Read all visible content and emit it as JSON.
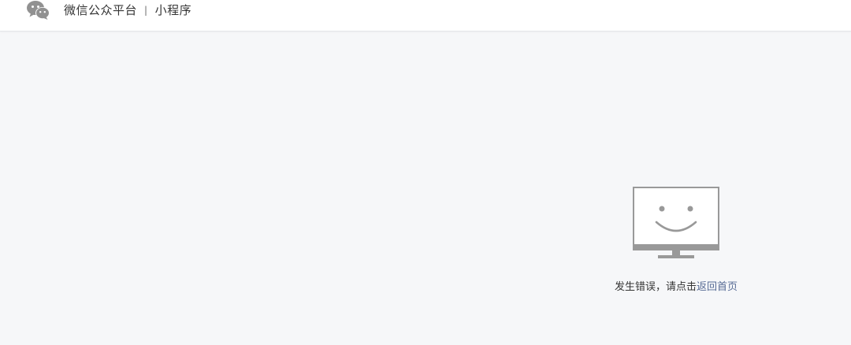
{
  "header": {
    "logo_icon": "wechat-logo-icon",
    "brand_name": "微信公众平台",
    "separator": "|",
    "product": "小程序"
  },
  "error": {
    "icon": "smiley-monitor-icon",
    "message": "发生错误，请点击",
    "link_label": "返回首页",
    "link_color": "#576b95"
  },
  "colors": {
    "page_background": "#f6f7f9",
    "header_background": "#ffffff",
    "icon_gray": "#999999"
  }
}
